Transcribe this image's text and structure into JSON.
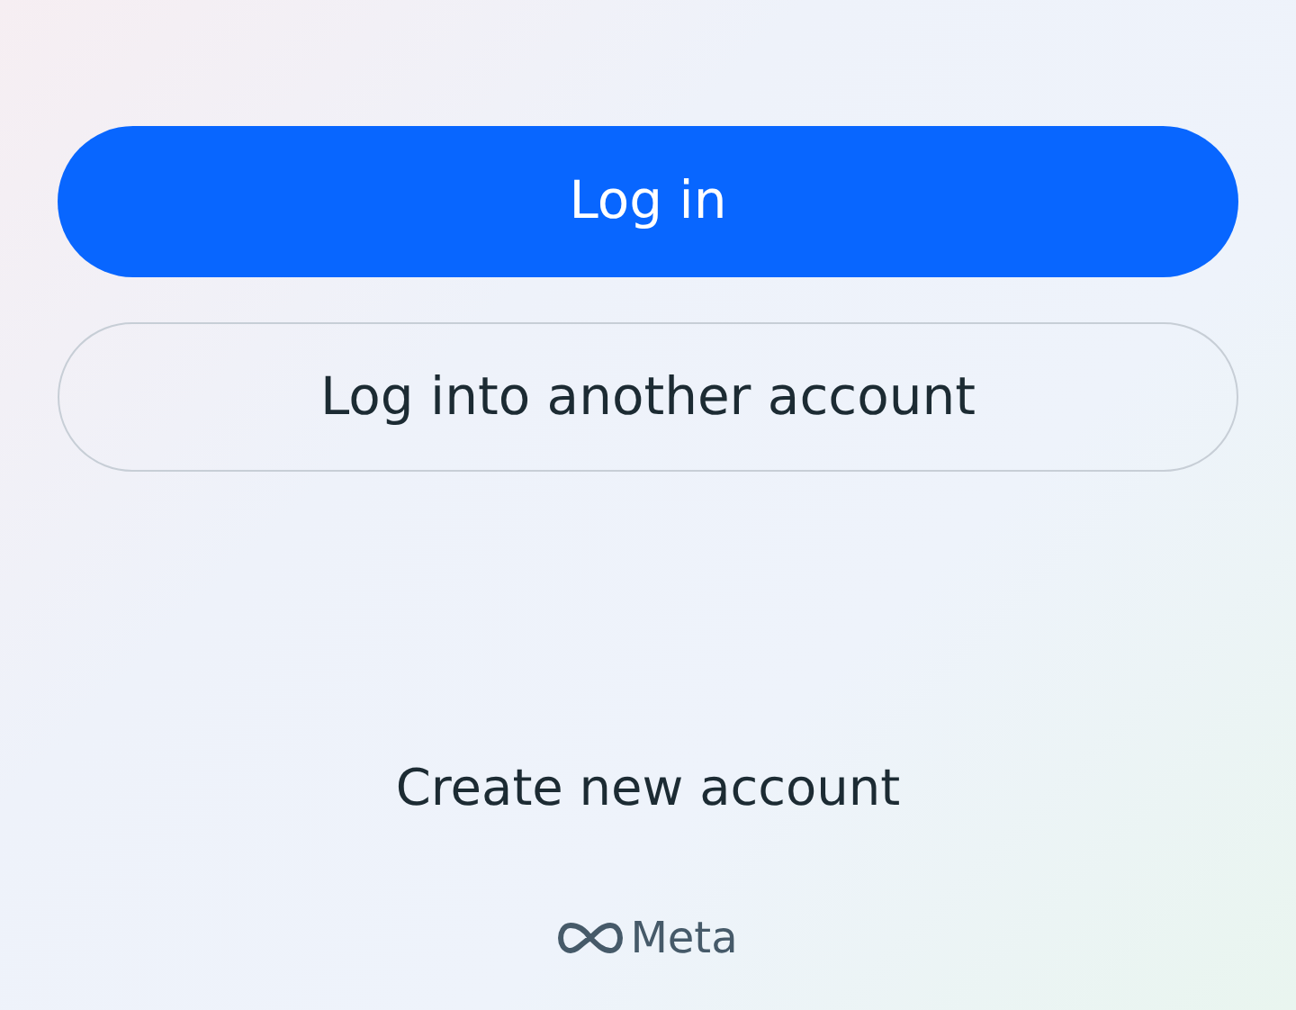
{
  "buttons": [
    {
      "label": "Log in",
      "kind": "primary"
    },
    {
      "label": "Log into another account",
      "kind": "outline"
    }
  ],
  "create_account": "Create new account",
  "footer": {
    "brand": "Meta"
  }
}
